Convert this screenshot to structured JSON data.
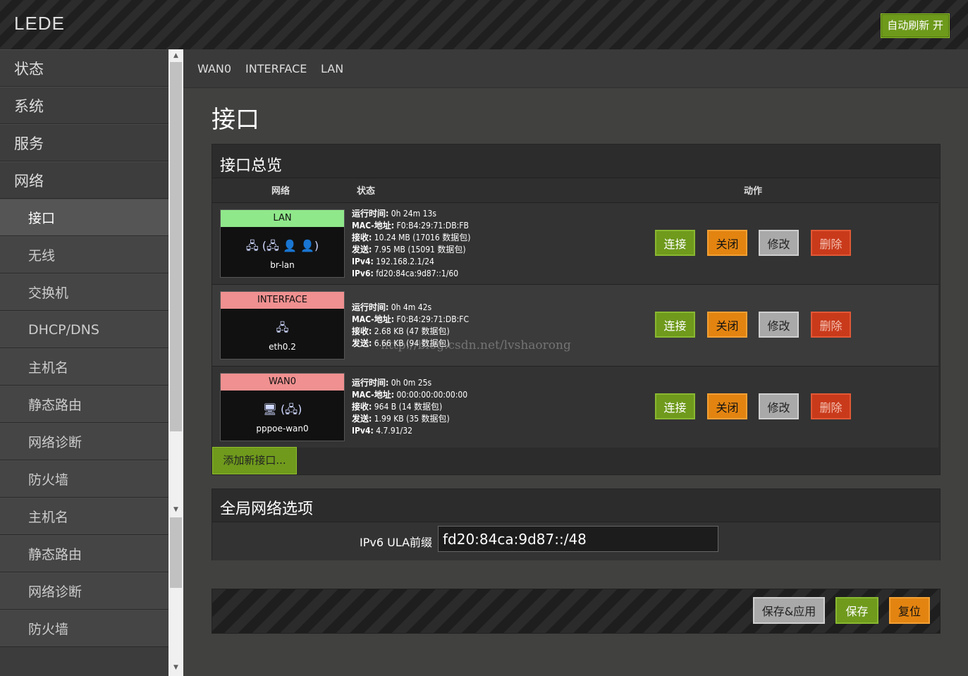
{
  "header": {
    "logo": "LEDE",
    "auto_refresh": "自动刷新 开"
  },
  "sidebar": {
    "items": [
      {
        "label": "状态",
        "level": 1
      },
      {
        "label": "系统",
        "level": 1
      },
      {
        "label": "服务",
        "level": 1
      },
      {
        "label": "网络",
        "level": 1
      },
      {
        "label": "接口",
        "level": 2,
        "active": true
      },
      {
        "label": "无线",
        "level": 2
      },
      {
        "label": "交换机",
        "level": 2
      },
      {
        "label": "DHCP/DNS",
        "level": 2
      },
      {
        "label": "主机名",
        "level": 2
      },
      {
        "label": "静态路由",
        "level": 2
      },
      {
        "label": "网络诊断",
        "level": 2
      },
      {
        "label": "防火墙",
        "level": 2
      },
      {
        "label": "主机名",
        "level": 2
      },
      {
        "label": "静态路由",
        "level": 2
      },
      {
        "label": "网络诊断",
        "level": 2
      },
      {
        "label": "防火墙",
        "level": 2
      }
    ]
  },
  "tabs": [
    "WAN0",
    "INTERFACE",
    "LAN"
  ],
  "page_title": "接口",
  "overview": {
    "title": "接口总览",
    "col_network": "网络",
    "col_status": "状态",
    "col_actions": "动作",
    "rows": [
      {
        "name": "LAN",
        "name_color": "#8fe88a",
        "icons": "🖧 (🖧 👤 👤)",
        "device": "br-lan",
        "lines": [
          [
            "运行时间:",
            "0h 24m 13s"
          ],
          [
            "MAC-地址:",
            "F0:B4:29:71:DB:FB"
          ],
          [
            "接收:",
            "10.24 MB (17016 数据包)"
          ],
          [
            "发送:",
            "7.95 MB (15091 数据包)"
          ],
          [
            "IPv4:",
            "192.168.2.1/24"
          ],
          [
            "IPv6:",
            "fd20:84ca:9d87::1/60"
          ]
        ]
      },
      {
        "name": "INTERFACE",
        "name_color": "#f09090",
        "icons": "🖧",
        "device": "eth0.2",
        "lines": [
          [
            "运行时间:",
            "0h 4m 42s"
          ],
          [
            "MAC-地址:",
            "F0:B4:29:71:DB:FC"
          ],
          [
            "接收:",
            "2.68 KB (47 数据包)"
          ],
          [
            "发送:",
            "6.66 KB (94 数据包)"
          ]
        ]
      },
      {
        "name": "WAN0",
        "name_color": "#f09090",
        "icons": "🖥 (🖧)",
        "device": "pppoe-wan0",
        "lines": [
          [
            "运行时间:",
            "0h 0m 25s"
          ],
          [
            "MAC-地址:",
            "00:00:00:00:00:00"
          ],
          [
            "接收:",
            "964 B (14 数据包)"
          ],
          [
            "发送:",
            "1.99 KB (35 数据包)"
          ],
          [
            "IPv4:",
            "4.7.91/32"
          ]
        ]
      }
    ],
    "buttons": {
      "connect": "连接",
      "stop": "关闭",
      "edit": "修改",
      "delete": "删除"
    },
    "add_button": "添加新接口..."
  },
  "global": {
    "title": "全局网络选项",
    "ula_label": "IPv6 ULA前缀",
    "ula_value": "fd20:84ca:9d87::/48"
  },
  "footer": {
    "save_apply": "保存&应用",
    "save": "保存",
    "reset": "复位"
  },
  "watermark": "http://blog.csdn.net/lvshaorong",
  "colors": {
    "green": "#6f9a1c",
    "orange": "#e38411",
    "red": "#c93a1b",
    "gray": "#a9a9a9"
  }
}
